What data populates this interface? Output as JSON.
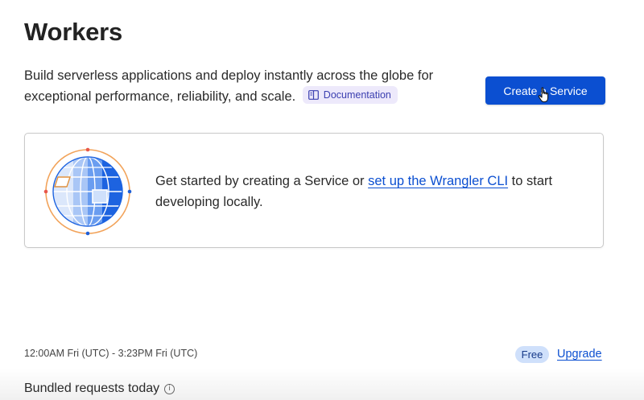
{
  "header": {
    "title": "Workers"
  },
  "intro": {
    "text": "Build serverless applications and deploy instantly across the globe for exceptional performance, reliability, and scale.",
    "doc_link": "Documentation"
  },
  "actions": {
    "create_service": "Create a Service"
  },
  "empty_state": {
    "text_before": "Get started by creating a Service or ",
    "link_text": "set up the Wrangler CLI",
    "text_after": " to start developing locally."
  },
  "usage": {
    "time_range": "12:00AM Fri (UTC) - 3:23PM Fri (UTC)",
    "plan_badge": "Free",
    "upgrade_link": "Upgrade",
    "bundled_label": "Bundled requests today",
    "info_glyph": "i"
  },
  "colors": {
    "primary": "#0b4fd1",
    "badge_bg": "#ede9fb",
    "plan_bg": "#cfe0fb",
    "globe_ring": "#f2a35a"
  },
  "icons": {
    "doc": "book-icon",
    "globe": "globe-illustration",
    "cursor": "hand-pointer-icon",
    "info": "info-icon"
  }
}
